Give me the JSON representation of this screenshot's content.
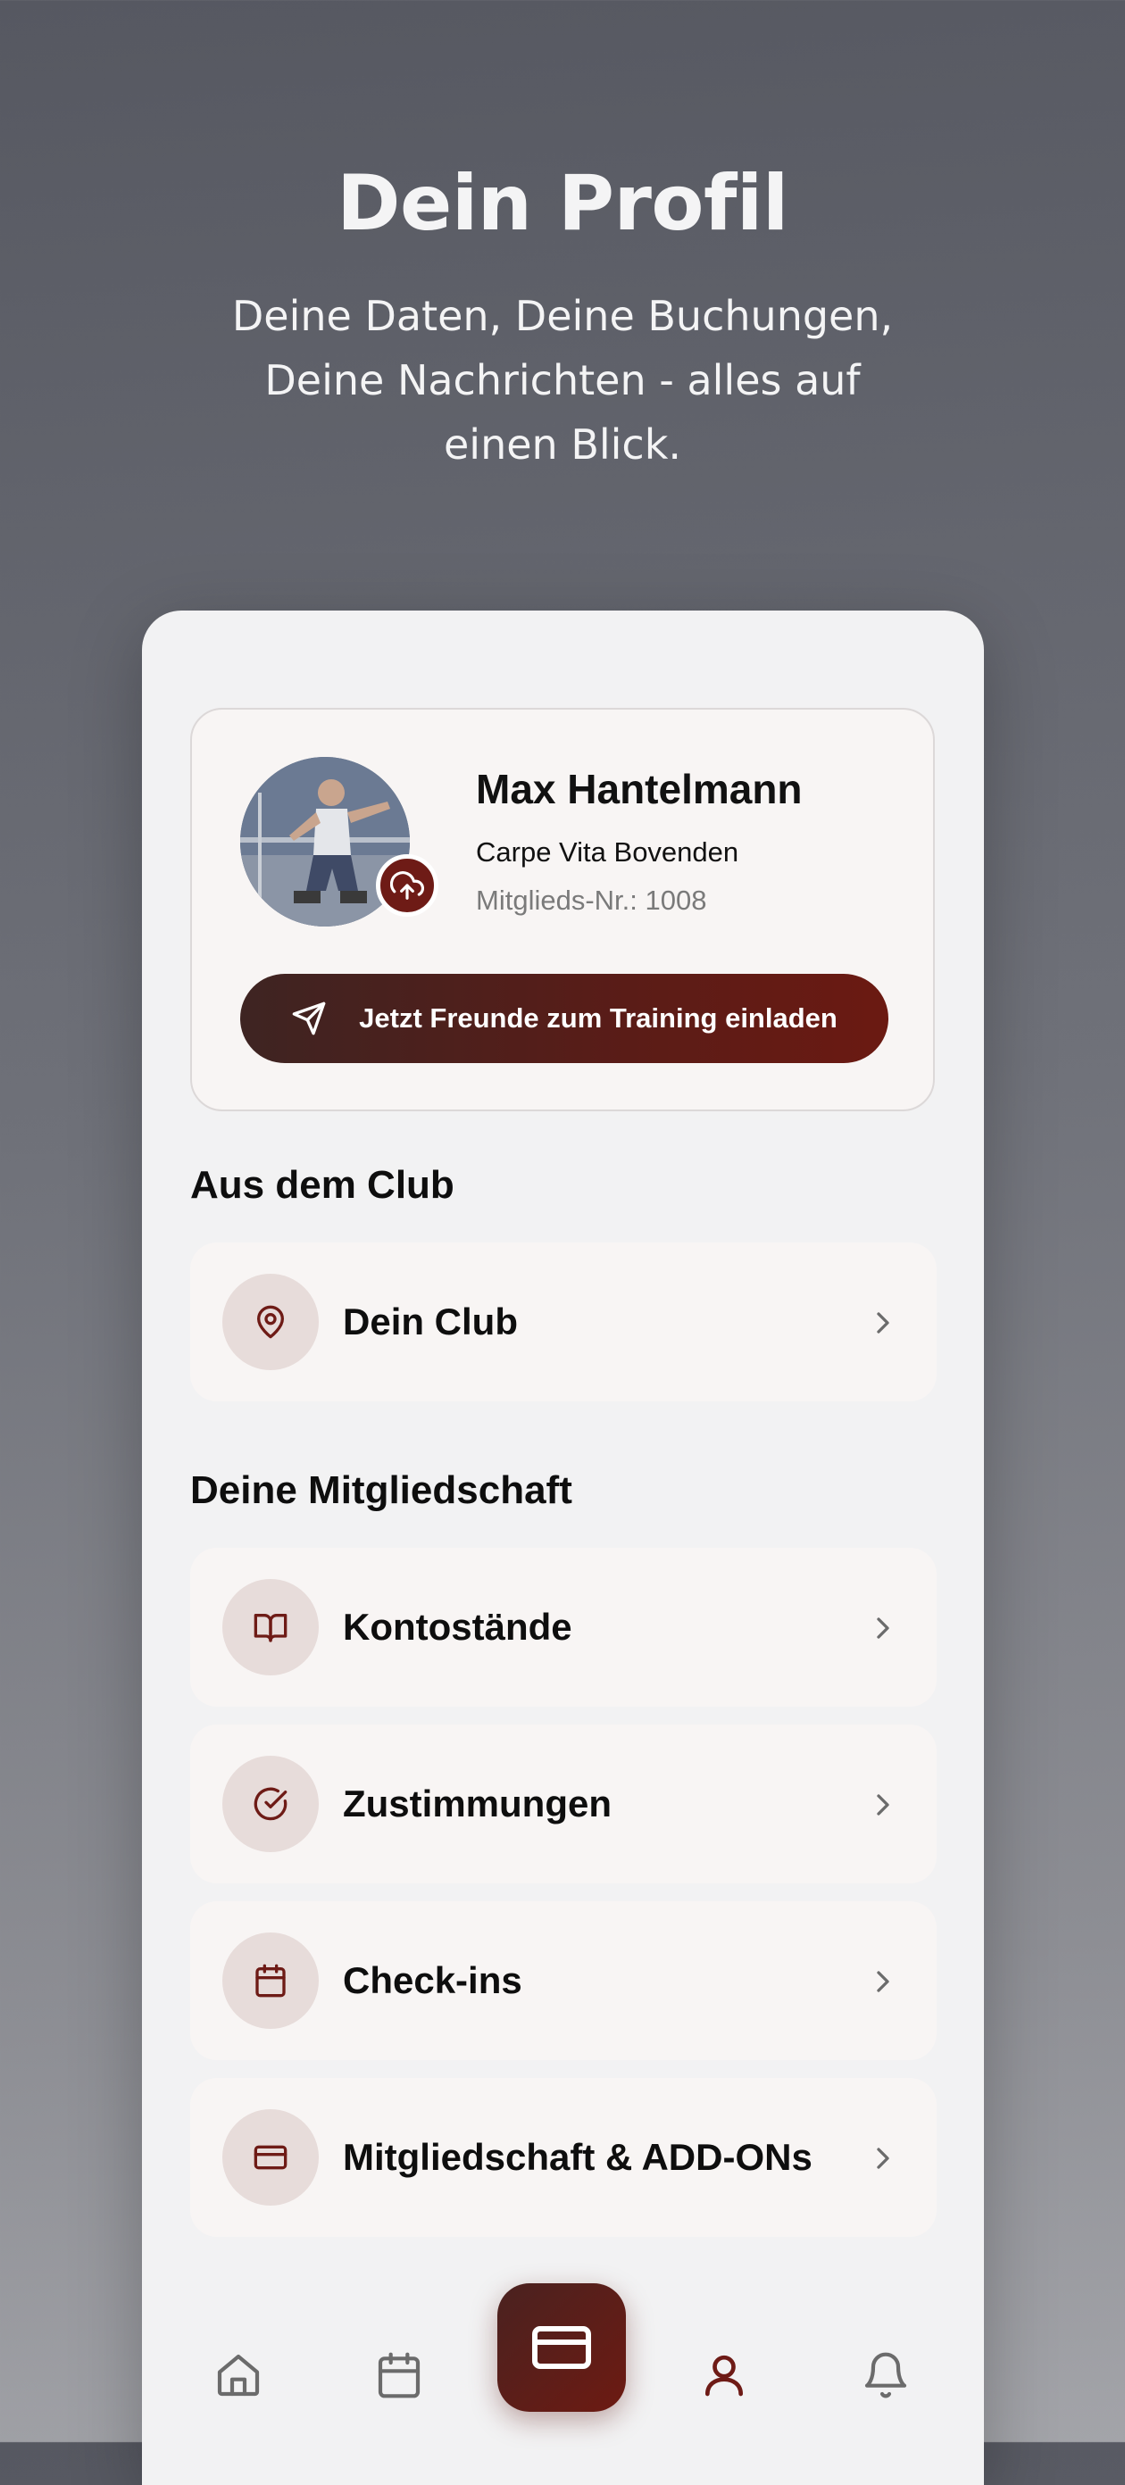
{
  "hero": {
    "title": "Dein Profil",
    "subtitle": "Deine Daten, Deine Buchungen, Deine Nachrichten - alles auf einen Blick."
  },
  "profile": {
    "name": "Max Hantelmann",
    "club": "Carpe Vita Bovenden",
    "member_number": "Mitglieds-Nr.: 1008",
    "invite_label": "Jetzt Freunde zum Training einladen"
  },
  "sections": {
    "club_title": "Aus dem Club",
    "membership_title": "Deine Mitgliedschaft"
  },
  "club_items": [
    {
      "label": "Dein Club",
      "icon": "map-pin-icon"
    }
  ],
  "membership_items": [
    {
      "label": "Kontostände",
      "icon": "book-open-icon"
    },
    {
      "label": "Zustimmungen",
      "icon": "check-circle-icon"
    },
    {
      "label": "Check-ins",
      "icon": "calendar-icon"
    },
    {
      "label": "Mitgliedschaft & ADD-ONs",
      "icon": "credit-card-icon"
    }
  ],
  "tabs": [
    {
      "name": "home",
      "icon": "home-icon",
      "active": false
    },
    {
      "name": "calendar",
      "icon": "calendar-icon",
      "active": false
    },
    {
      "name": "card",
      "icon": "credit-card-icon",
      "active": false,
      "highlighted": true
    },
    {
      "name": "profile",
      "icon": "user-icon",
      "active": true
    },
    {
      "name": "notifications",
      "icon": "bell-icon",
      "active": false
    }
  ],
  "colors": {
    "accent": "#6e1b16",
    "icon_circle": "#e7dcda",
    "card_bg": "#f8f5f4"
  }
}
